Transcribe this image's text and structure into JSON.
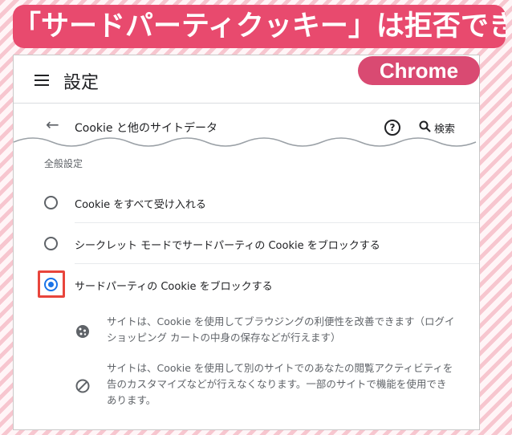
{
  "headline": "「サードパーティクッキー」は拒否できる",
  "browser_badge": "Chrome",
  "header": {
    "title": "設定"
  },
  "subheader": {
    "title": "Cookie と他のサイトデータ",
    "search_label": "検索"
  },
  "section_label": "全般設定",
  "options": [
    {
      "label": "Cookie をすべて受け入れる",
      "selected": false
    },
    {
      "label": "シークレット モードでサードパーティの Cookie をブロックする",
      "selected": false
    },
    {
      "label": "サードパーティの Cookie をブロックする",
      "selected": true
    }
  ],
  "descriptions": [
    {
      "icon": "cookie-icon",
      "lines": [
        "サイトは、Cookie を使用してブラウジングの利便性を改善できます（ログイ",
        "ショッピング カートの中身の保存などが行えます）"
      ]
    },
    {
      "icon": "block-icon",
      "lines": [
        "サイトは、Cookie を使用して別のサイトでのあなたの閲覧アクティビティを",
        "告のカスタマイズなどが行えなくなります。一部のサイトで機能を使用でき",
        "あります。"
      ]
    }
  ],
  "colors": {
    "headline_bg": "#e84a6e",
    "badge_bg": "#d94a72",
    "radio_selected": "#1a73e8",
    "highlight": "#e8453c"
  }
}
